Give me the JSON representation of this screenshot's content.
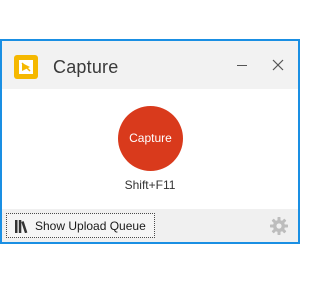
{
  "window": {
    "title": "Capture",
    "icon": "capture-app-icon",
    "controls": [
      "minimize-icon",
      "close-icon"
    ]
  },
  "main": {
    "capture_label": "Capture",
    "shortcut": "Shift+F11"
  },
  "footer": {
    "upload_label": "Show Upload Queue",
    "upload_icon": "books-icon",
    "settings_icon": "gear-icon"
  },
  "colors": {
    "frame": "#1a8fe3",
    "titlebar": "#f2f2f2",
    "app_icon": "#f5b800",
    "capture_button": "#d93a1c",
    "footer": "#f0f0f0"
  }
}
